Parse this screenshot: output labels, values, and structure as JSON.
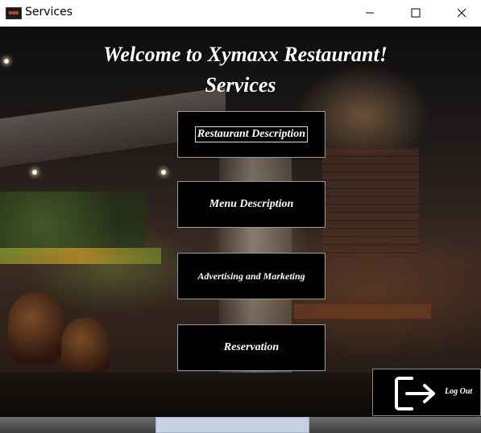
{
  "window": {
    "title": "Services",
    "icon": "restaurant-app-icon",
    "controls": [
      "minimize-icon",
      "maximize-icon",
      "close-icon"
    ]
  },
  "main": {
    "welcome_heading": "Welcome to Xymaxx Restaurant!",
    "section_heading": "Services",
    "background": "restaurant interior photo"
  },
  "services": [
    {
      "label": "Restaurant Description"
    },
    {
      "label": "Menu Description"
    },
    {
      "label": "Advertising and Marketing"
    },
    {
      "label": "Reservation"
    }
  ],
  "logout": {
    "label": "Log Out",
    "icon": "logout-arrow-icon"
  },
  "colors": {
    "button_bg": "#000000",
    "button_text": "#ffffff",
    "titlebar_bg": "#ffffff"
  }
}
